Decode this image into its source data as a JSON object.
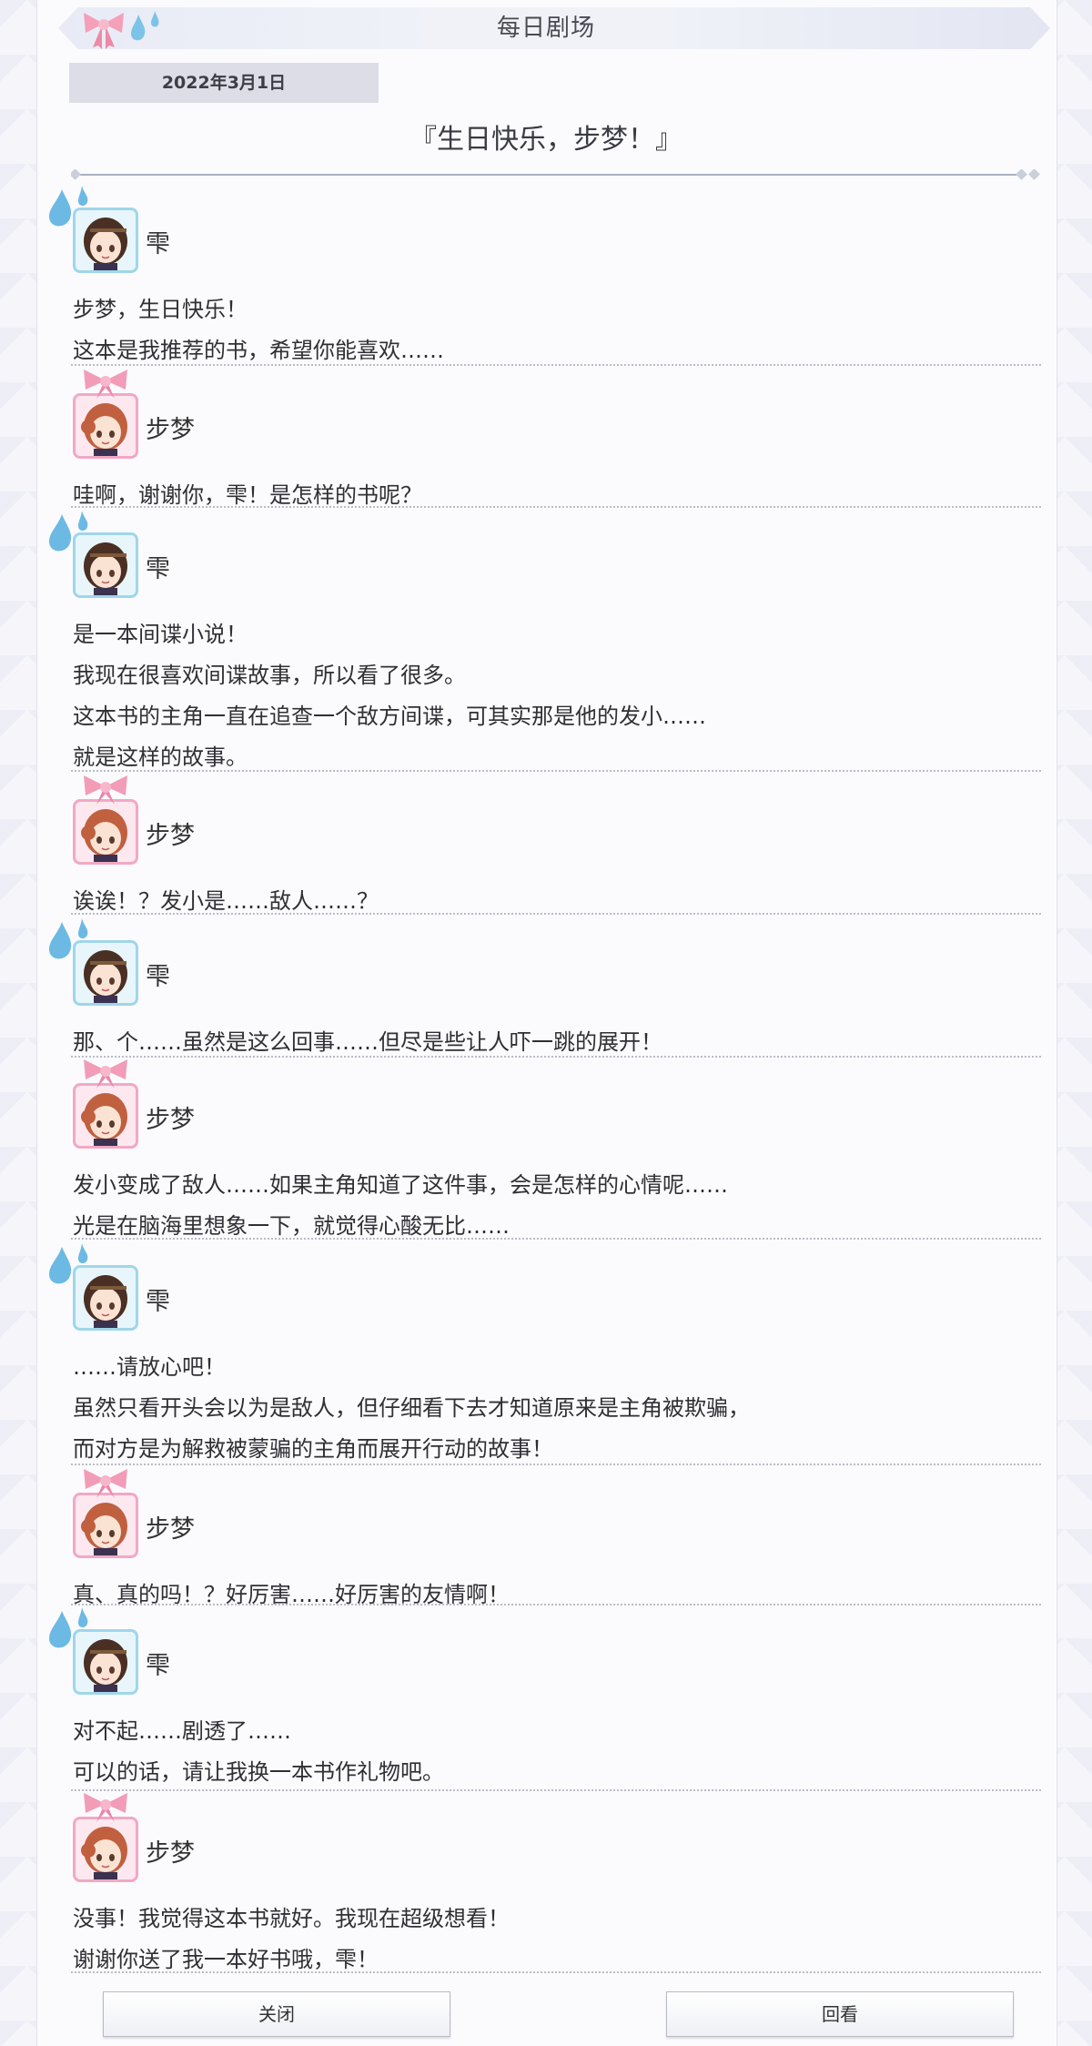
{
  "header": {
    "title": "每日剧场",
    "date": "2022年3月1日",
    "episode_title": "『生日快乐，步梦！』"
  },
  "icons": {
    "header_left": "pink-ribbon-icon",
    "header_right": "water-drops-icon"
  },
  "colors": {
    "shizuku_accent": "#9fd6ea",
    "ayumu_accent": "#f2a8c4"
  },
  "dialogue": [
    {
      "speaker": "雫",
      "lines": [
        "步梦，生日快乐！",
        "这本是我推荐的书，希望你能喜欢……"
      ]
    },
    {
      "speaker": "步梦",
      "lines": [
        "哇啊，谢谢你，雫！是怎样的书呢？"
      ]
    },
    {
      "speaker": "雫",
      "lines": [
        "是一本间谍小说！",
        "我现在很喜欢间谍故事，所以看了很多。",
        "这本书的主角一直在追查一个敌方间谍，可其实那是他的发小……",
        "就是这样的故事。"
      ]
    },
    {
      "speaker": "步梦",
      "lines": [
        "诶诶！？发小是……敌人……？"
      ]
    },
    {
      "speaker": "雫",
      "lines": [
        "那、个……虽然是这么回事……但尽是些让人吓一跳的展开！"
      ]
    },
    {
      "speaker": "步梦",
      "lines": [
        "发小变成了敌人……如果主角知道了这件事，会是怎样的心情呢……",
        "光是在脑海里想象一下，就觉得心酸无比……"
      ]
    },
    {
      "speaker": "雫",
      "lines": [
        "……请放心吧！",
        "虽然只看开头会以为是敌人，但仔细看下去才知道原来是主角被欺骗，",
        "而对方是为解救被蒙骗的主角而展开行动的故事！"
      ]
    },
    {
      "speaker": "步梦",
      "lines": [
        "真、真的吗！？好厉害……好厉害的友情啊！"
      ]
    },
    {
      "speaker": "雫",
      "lines": [
        "对不起……剧透了……",
        "可以的话，请让我换一本书作礼物吧。"
      ]
    },
    {
      "speaker": "步梦",
      "lines": [
        "没事！我觉得这本书就好。我现在超级想看！",
        "谢谢你送了我一本好书哦，雫！"
      ]
    }
  ],
  "footer": {
    "close_label": "关闭",
    "replay_label": "回看"
  }
}
